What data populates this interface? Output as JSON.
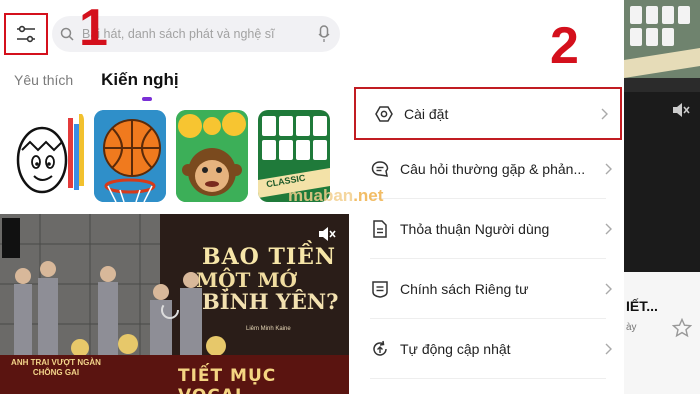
{
  "step_labels": {
    "step1": "1",
    "step2": "2"
  },
  "search": {
    "placeholder": "Bài hát, danh sách phát và nghệ sĩ"
  },
  "tabs": [
    {
      "label": "Yêu thích",
      "active": false
    },
    {
      "label": "Kiến nghị",
      "active": true
    }
  ],
  "games": [
    {
      "name": "Coloring egg",
      "icon": "egg-character-icon"
    },
    {
      "name": "Basketball",
      "icon": "basketball-icon"
    },
    {
      "name": "Emoji monkey",
      "icon": "monkey-emoji-icon"
    },
    {
      "name": "Solitaire Classic",
      "icon": "playing-cards-icon",
      "caption": "CLASSIC"
    }
  ],
  "video": {
    "title_line1": "BAO TIỀN",
    "title_line2": "MỘT MỚ",
    "title_line3": "BÌNH YÊN?",
    "artist": "Liêm Minh Kaine",
    "show_name": "ANH TRAI VƯỢT NGÀN CHÔNG GAI",
    "banner": "TIẾT MỤC VOCAL"
  },
  "menu": [
    {
      "label": "Cài đặt",
      "icon": "gear-hexagon-icon",
      "highlighted": true
    },
    {
      "label": "Câu hỏi thường gặp & phản...",
      "icon": "chat-bubble-icon",
      "highlighted": false
    },
    {
      "label": "Thỏa thuận Người dùng",
      "icon": "document-icon",
      "highlighted": false
    },
    {
      "label": "Chính sách Riêng tư",
      "icon": "shield-doc-icon",
      "highlighted": false
    },
    {
      "label": "Tự động cập nhật",
      "icon": "refresh-up-icon",
      "highlighted": false
    }
  ],
  "watermark": {
    "text": "muaban",
    "suffix": ".net"
  },
  "strip": {
    "text": "IẾT...",
    "sub": "ày"
  },
  "colors": {
    "accent_red": "#d4101c",
    "tab_indicator": "#7a2fd6"
  }
}
